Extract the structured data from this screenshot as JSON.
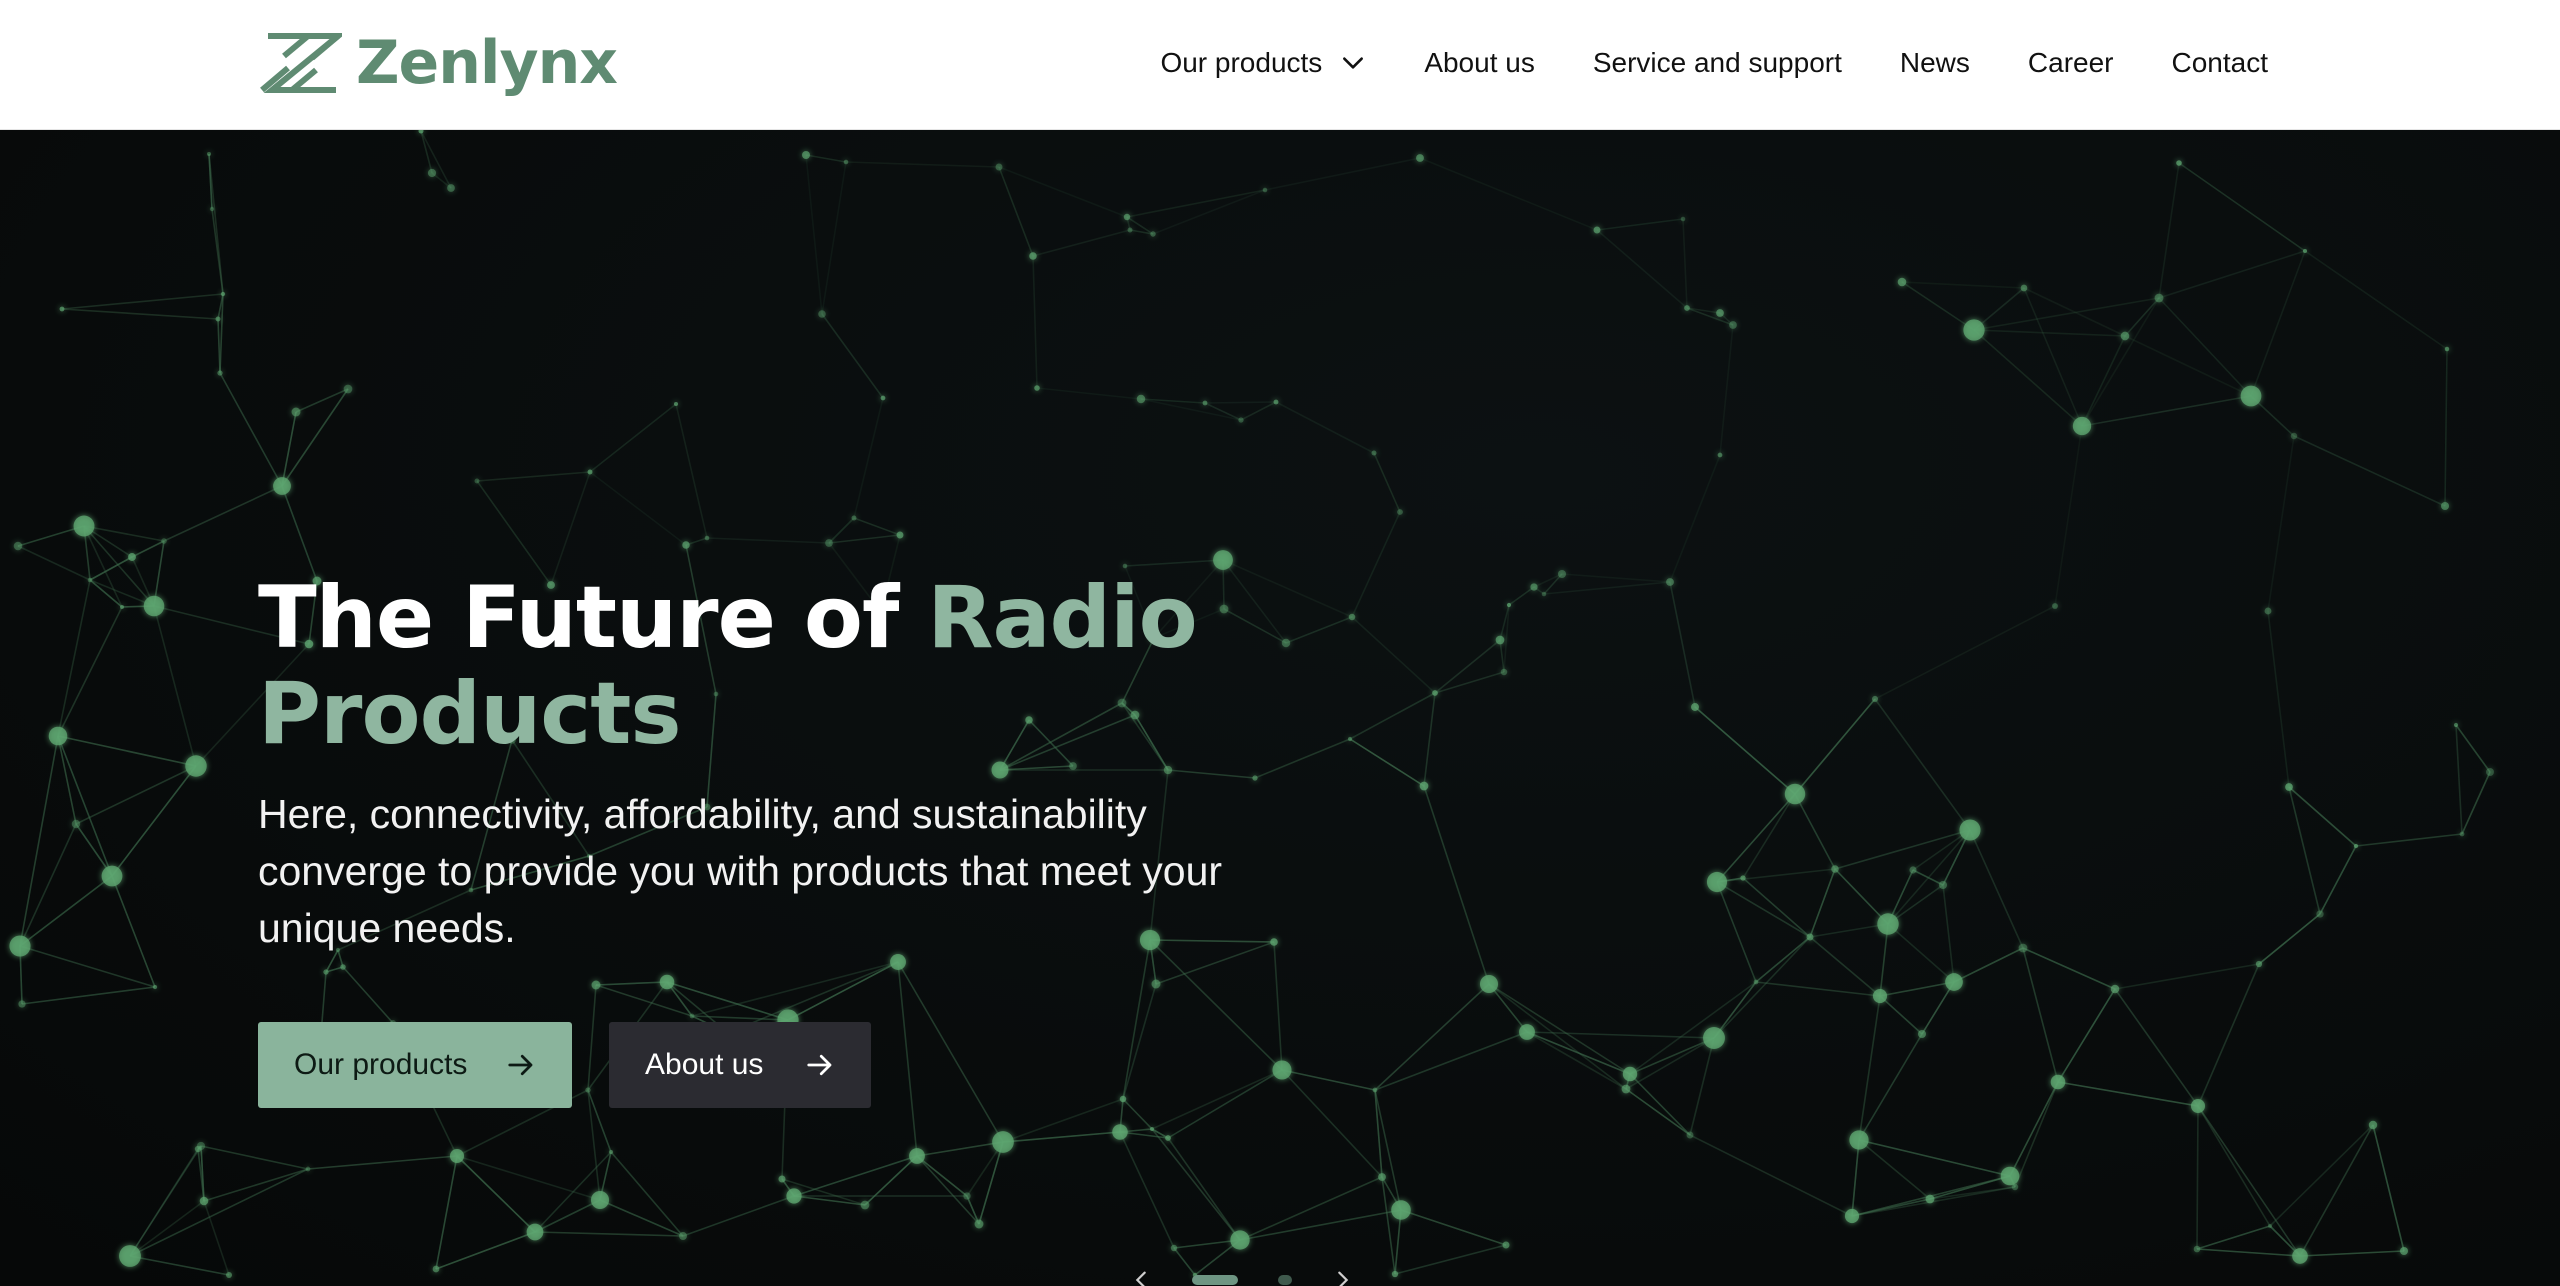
{
  "header": {
    "logo_text": "Zenlynx",
    "logo_icon": "zenlynx-logo-icon",
    "nav": [
      {
        "label": "Our products",
        "has_dropdown": true,
        "icon": "chevron-down-icon"
      },
      {
        "label": "About us"
      },
      {
        "label": "Service and support"
      },
      {
        "label": "News"
      },
      {
        "label": "Career"
      },
      {
        "label": "Contact"
      }
    ]
  },
  "hero": {
    "title_main": "The Future of ",
    "title_accent": "Radio Products",
    "subtitle": "Here, connectivity, affordability, and sustainability converge to provide you with products that meet your unique needs.",
    "buttons": [
      {
        "label": "Our products",
        "icon": "arrow-right-icon"
      },
      {
        "label": "About us",
        "icon": "arrow-right-icon"
      }
    ],
    "carousel": {
      "prev_icon": "chevron-left-icon",
      "next_icon": "chevron-right-icon"
    }
  },
  "colors": {
    "brand": "#5f8b72",
    "accent": "#8fb6a0",
    "primary_button": "#8ab49c",
    "secondary_button": "#2b2b31",
    "hero_background": "#080b0b",
    "network_line": "#3d6b4c",
    "network_node": "#5fa872"
  }
}
